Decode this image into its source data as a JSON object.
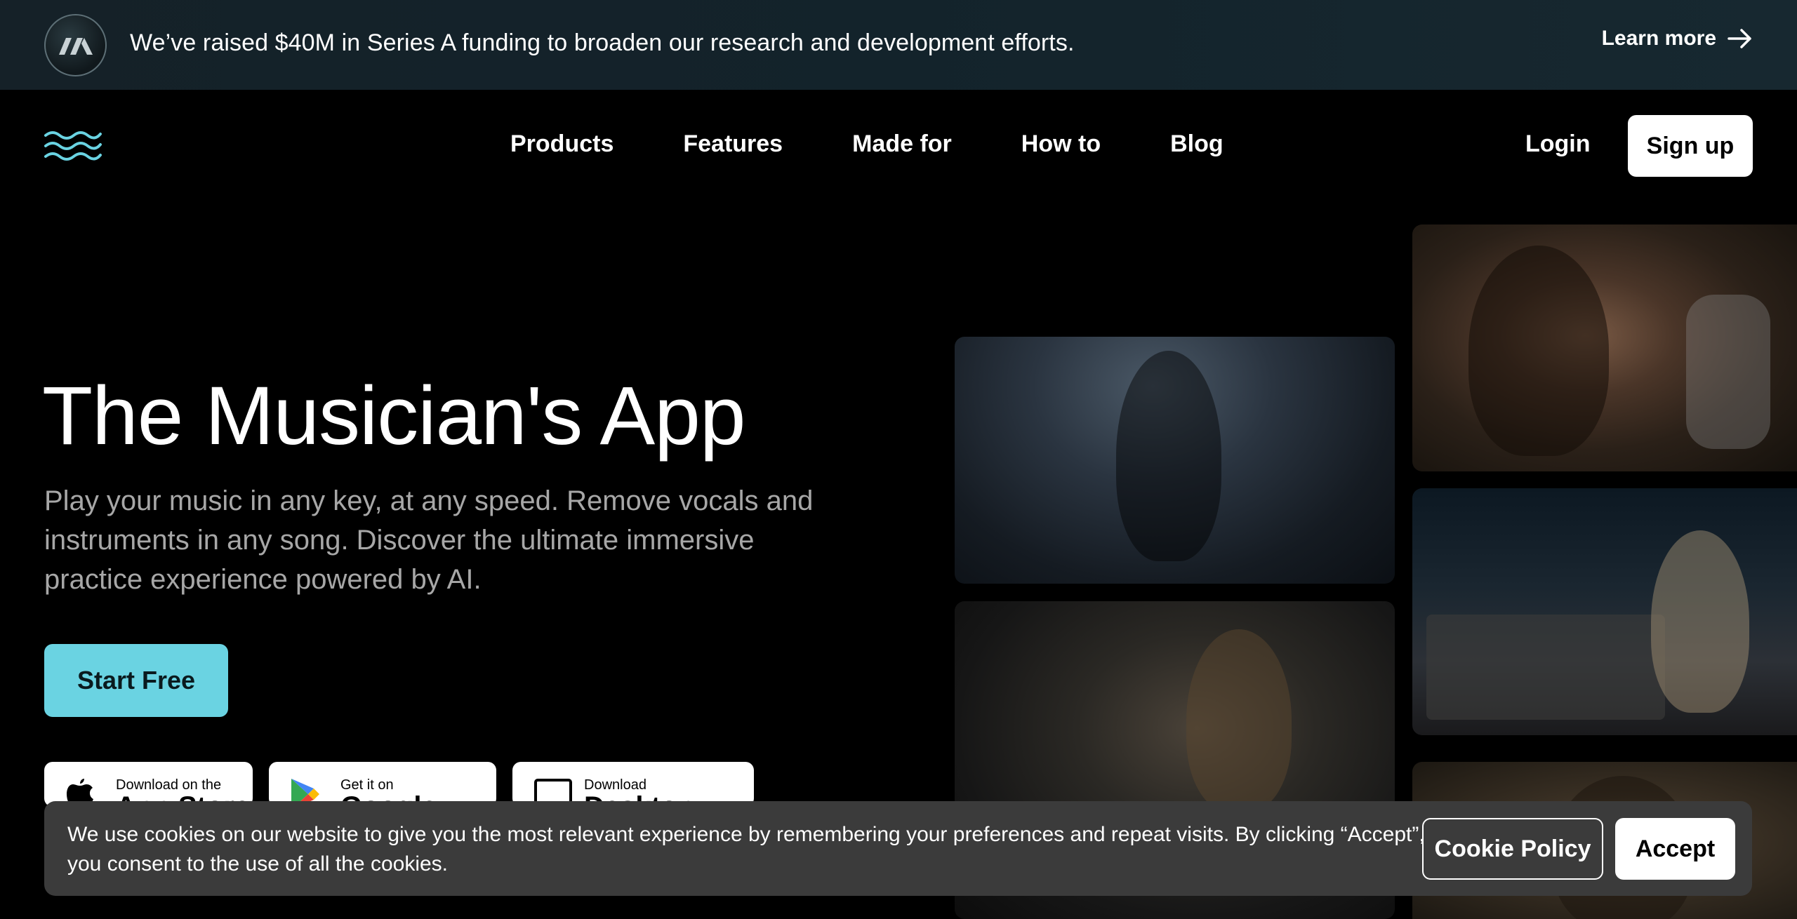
{
  "announcement": {
    "text": "We’ve raised $40M in Series A funding to broaden our research and development efforts.",
    "link_label": "Learn more"
  },
  "nav": {
    "links": [
      "Products",
      "Features",
      "Made for",
      "How to",
      "Blog"
    ],
    "login_label": "Login",
    "signup_label": "Sign up"
  },
  "hero": {
    "title": "The Musician's App",
    "description": "Play your music in any key, at any speed. Remove vocals and instruments in any song. Discover the ultimate immersive practice experience powered by AI.",
    "cta_label": "Start Free"
  },
  "downloads": [
    {
      "small": "Download on the",
      "big": "App Store",
      "icon": "apple-icon"
    },
    {
      "small": "Get it on",
      "big": "Google Play",
      "icon": "google-play-icon"
    },
    {
      "small": "Download",
      "big": "Desktop App",
      "icon": "desktop-icon"
    }
  ],
  "cookie": {
    "text": "We use cookies on our website to give you the most relevant experience by remembering your preferences and repeat visits. By clicking “Accept”, you consent to the use of all the cookies.",
    "policy_label": "Cookie Policy",
    "accept_label": "Accept"
  },
  "colors": {
    "accent": "#6ad3e2",
    "announce_bg": "#152128",
    "cookie_bg": "#3b3b3b"
  }
}
